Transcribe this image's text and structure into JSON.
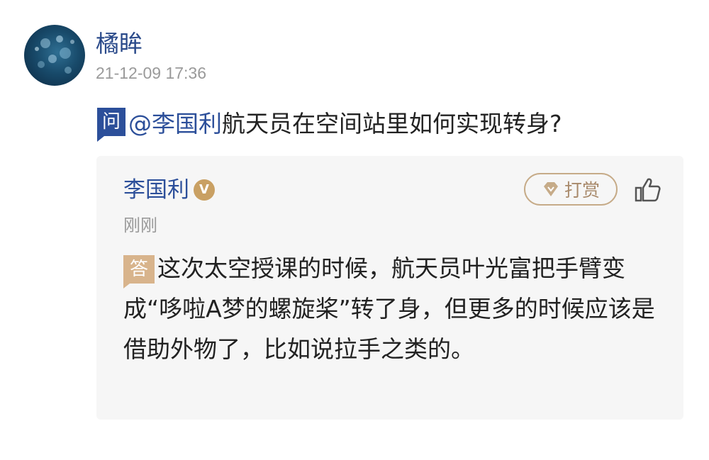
{
  "post": {
    "author": "橘眸",
    "timestamp": "21-12-09 17:36",
    "avatar_icon": "jellyfish-avatar"
  },
  "question": {
    "badge": "问",
    "mention": "@李国利",
    "text": "航天员在空间站里如何实现转身?"
  },
  "answer": {
    "author": "李国利",
    "verified_badge": "V",
    "time": "刚刚",
    "reward_label": "打赏",
    "reward_icon": "gem-icon",
    "like_icon": "thumbs-up-icon",
    "badge": "答",
    "text": "这次太空授课的时候，航天员叶光富把手臂变成“哆啦A梦的螺旋桨”转了身，但更多的时候应该是借助外物了，比如说拉手之类的。"
  },
  "colors": {
    "link_blue": "#2c4f9a",
    "answer_badge": "#d8b48c",
    "reward_border": "#c6ab88",
    "verified": "#c9a063",
    "card_bg": "#f6f6f6"
  }
}
